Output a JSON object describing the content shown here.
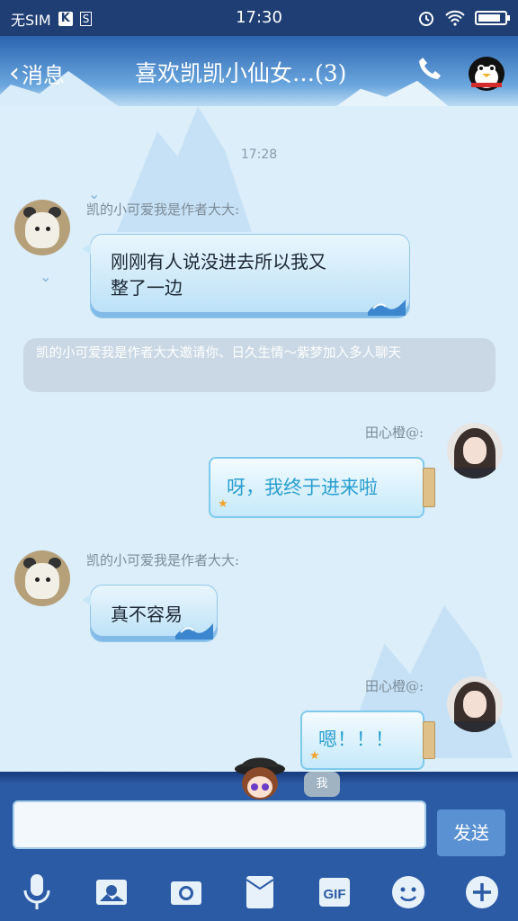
{
  "status": {
    "carrier": "无SIM",
    "k_icon": "K",
    "s_icon": "S",
    "time": "17:30"
  },
  "header": {
    "back_label": "消息",
    "title": "喜欢凯凯小仙女…(3)"
  },
  "chat": {
    "timestamp": "17:28",
    "messages": [
      {
        "sender": "凯的小可爱我是作者大大:",
        "text_line1": "刚刚有人说没进去所以我又",
        "text_line2": "整了一边"
      },
      {
        "system": "凯的小可爱我是作者大大邀请你、日久生情～紫梦加入多人聊天"
      },
      {
        "sender": "田心橙@:",
        "text": "呀，我终于进来啦"
      },
      {
        "sender": "凯的小可爱我是作者大大:",
        "text": "真不容易"
      },
      {
        "sender": "田心橙@:",
        "text": "嗯！！！"
      }
    ]
  },
  "composer": {
    "me_label": "我",
    "input_value": "",
    "send_label": "发送"
  },
  "toolbar": {
    "items": [
      "mic-icon",
      "photo-icon",
      "camera-icon",
      "envelope-icon",
      "gif-icon",
      "emoji-icon",
      "plus-icon"
    ],
    "gif_label": "GIF"
  },
  "colors": {
    "status_bar": "#1f3e74",
    "bottom_bar": "#2c5ba6",
    "chat_bg": "#dbeefa"
  }
}
